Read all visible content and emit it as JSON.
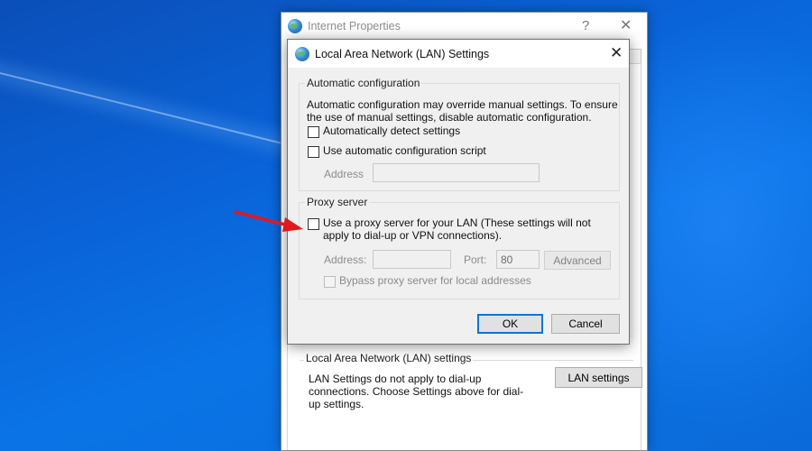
{
  "background_window": {
    "title": "Internet Properties",
    "help_glyph": "?",
    "close_glyph": "✕",
    "lan_section": {
      "legend": "Local Area Network (LAN) settings",
      "description": "LAN Settings do not apply to dial-up connections. Choose Settings above for dial-up settings.",
      "button_label": "LAN settings"
    }
  },
  "dialog": {
    "title": "Local Area Network (LAN) Settings",
    "close_glyph": "✕",
    "auto_config": {
      "legend": "Automatic configuration",
      "description": "Automatic configuration may override manual settings.  To ensure the use of manual settings, disable automatic configuration.",
      "detect_label": "Automatically detect settings",
      "detect_checked": false,
      "script_label": "Use automatic configuration script",
      "script_checked": false,
      "address_label": "Address",
      "address_value": ""
    },
    "proxy": {
      "legend": "Proxy server",
      "use_proxy_label": "Use a proxy server for your LAN (These settings will not apply to dial-up or VPN connections).",
      "use_proxy_checked": false,
      "address_label": "Address:",
      "address_value": "",
      "port_label": "Port:",
      "port_value": "80",
      "advanced_label": "Advanced",
      "bypass_label": "Bypass proxy server for local addresses",
      "bypass_checked": false
    },
    "ok_label": "OK",
    "cancel_label": "Cancel"
  },
  "annotation": {
    "arrow_color": "#e0191f"
  },
  "colors": {
    "desktop_blue": "#0a63d8",
    "focus_border": "#0078d7"
  }
}
